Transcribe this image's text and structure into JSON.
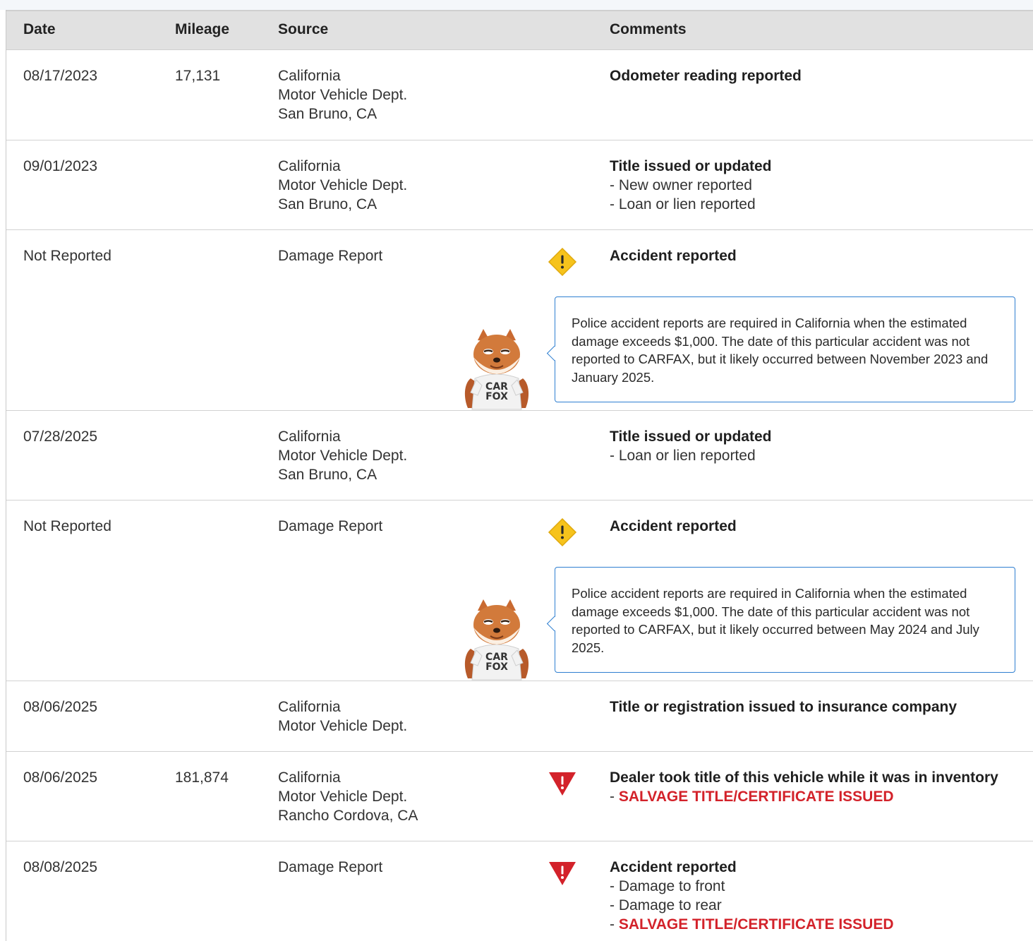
{
  "header": {
    "date": "Date",
    "mileage": "Mileage",
    "source": "Source",
    "comments": "Comments"
  },
  "rows": [
    {
      "date": "08/17/2023",
      "mileage": "17,131",
      "source": [
        "California",
        "Motor Vehicle Dept.",
        "San Bruno, CA"
      ],
      "title": "Odometer reading reported",
      "details": []
    },
    {
      "date": "09/01/2023",
      "mileage": "",
      "source": [
        "California",
        "Motor Vehicle Dept.",
        "San Bruno, CA"
      ],
      "title": "Title issued or updated",
      "details": [
        "New owner reported",
        "Loan or lien reported"
      ]
    },
    {
      "date": "Not Reported",
      "mileage": "",
      "source": [
        "Damage Report"
      ],
      "icon": "warning-diamond-icon",
      "title": "Accident reported",
      "details": [],
      "note": "Police accident reports are required in California when the estimated damage exceeds $1,000. The date of this particular accident was not reported to CARFAX, but it likely occurred between November 2023 and January 2025."
    },
    {
      "date": "07/28/2025",
      "mileage": "",
      "source": [
        "California",
        "Motor Vehicle Dept.",
        "San Bruno, CA"
      ],
      "title": "Title issued or updated",
      "details": [
        "Loan or lien reported"
      ]
    },
    {
      "date": "Not Reported",
      "mileage": "",
      "source": [
        "Damage Report"
      ],
      "icon": "warning-diamond-icon",
      "title": "Accident reported",
      "details": [],
      "note": "Police accident reports are required in California when the estimated damage exceeds $1,000. The date of this particular accident was not reported to CARFAX, but it likely occurred between May 2024 and July 2025."
    },
    {
      "date": "08/06/2025",
      "mileage": "",
      "source": [
        "California",
        "Motor Vehicle Dept."
      ],
      "title": "Title or registration issued to insurance company",
      "details": []
    },
    {
      "date": "08/06/2025",
      "mileage": "181,874",
      "source": [
        "California",
        "Motor Vehicle Dept.",
        "Rancho Cordova, CA"
      ],
      "icon": "alert-triangle-icon",
      "title": "Dealer took title of this vehicle while it was in inventory",
      "details": [],
      "alert": "SALVAGE TITLE/CERTIFICATE ISSUED"
    },
    {
      "date": "08/08/2025",
      "mileage": "",
      "source": [
        "Damage Report"
      ],
      "icon": "alert-triangle-icon",
      "title": "Accident reported",
      "details": [
        "Damage to front",
        "Damage to rear"
      ],
      "alert": "SALVAGE TITLE/CERTIFICATE ISSUED"
    }
  ],
  "mascot": {
    "shirt_text": [
      "CAR",
      "FOX"
    ]
  },
  "colors": {
    "header_bg": "#e1e1e1",
    "warning_yellow": "#f6c31c",
    "alert_red": "#d3222a",
    "bubble_border": "#2f7fd1"
  }
}
